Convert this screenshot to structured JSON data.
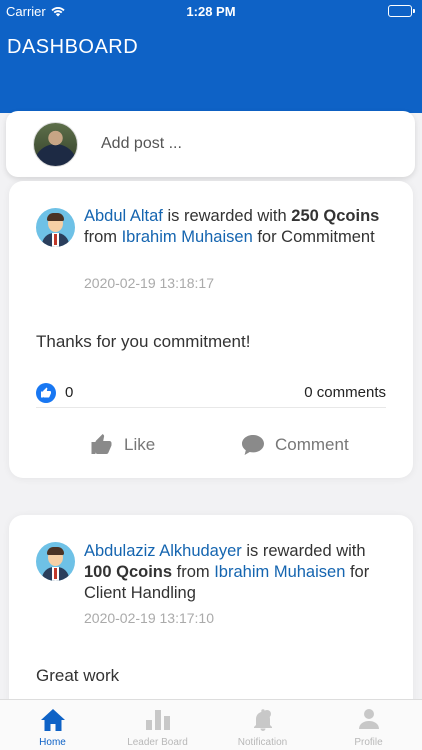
{
  "status_bar": {
    "carrier": "Carrier",
    "time": "1:28 PM"
  },
  "header": {
    "title": "DASHBOARD"
  },
  "add_post": {
    "placeholder": "Add post ..."
  },
  "posts": [
    {
      "recipient": "Abdul Altaf",
      "rewarded_text": " is rewarded with ",
      "amount": "250 Qcoins",
      "from_text": " from ",
      "sender": "Ibrahim Muhaisen",
      "for_text": " for Commitment",
      "timestamp": "2020-02-19 13:18:17",
      "message": "Thanks for you commitment!",
      "likes": "0",
      "comments": "0 comments",
      "like_label": "Like",
      "comment_label": "Comment"
    },
    {
      "recipient": "Abdulaziz Alkhudayer",
      "rewarded_text": " is rewarded with ",
      "amount": "100 Qcoins",
      "from_text": " from ",
      "sender": "Ibrahim Muhaisen",
      "for_text": " for Client Handling",
      "timestamp": "2020-02-19 13:17:10",
      "message": "Great work"
    }
  ],
  "tabs": [
    {
      "label": "Home",
      "icon": "home-icon",
      "active": true
    },
    {
      "label": "Leader Board",
      "icon": "bar-chart-icon",
      "active": false
    },
    {
      "label": "Notification",
      "icon": "bell-icon",
      "active": false
    },
    {
      "label": "Profile",
      "icon": "person-icon",
      "active": false
    }
  ],
  "colors": {
    "primary": "#0e62c6",
    "link": "#1565b0",
    "like_badge": "#1877f2"
  }
}
